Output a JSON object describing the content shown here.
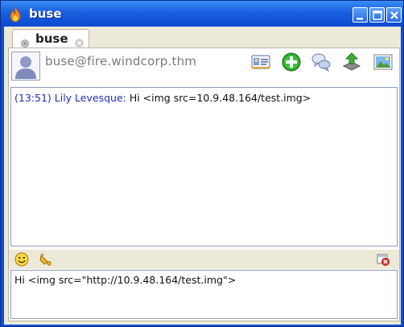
{
  "window": {
    "title": "buse",
    "accent": "#0c49d0"
  },
  "tab": {
    "label": "buse",
    "status_icon": "offline-status-icon",
    "close_icon": "close-icon"
  },
  "contact": {
    "address": "buse@fire.windcorp.thm",
    "avatar_icon": "user-avatar-icon"
  },
  "toolbar": {
    "icons": [
      "vcard-icon",
      "add-contact-icon",
      "chat-bubbles-icon",
      "file-transfer-icon",
      "picture-icon"
    ]
  },
  "conversation": {
    "messages": [
      {
        "time": "(13:51)",
        "sender": "Lily Levesque:",
        "text": "Hi <img src=10.9.48.164/test.img>"
      }
    ],
    "sender_color": "#1c2fb8"
  },
  "format_bar": {
    "icons": [
      "smiley-icon",
      "nudge-bell-icon",
      "clear-history-icon"
    ]
  },
  "compose": {
    "value": "Hi <img src=\"http://10.9.48.164/test.img\">"
  }
}
